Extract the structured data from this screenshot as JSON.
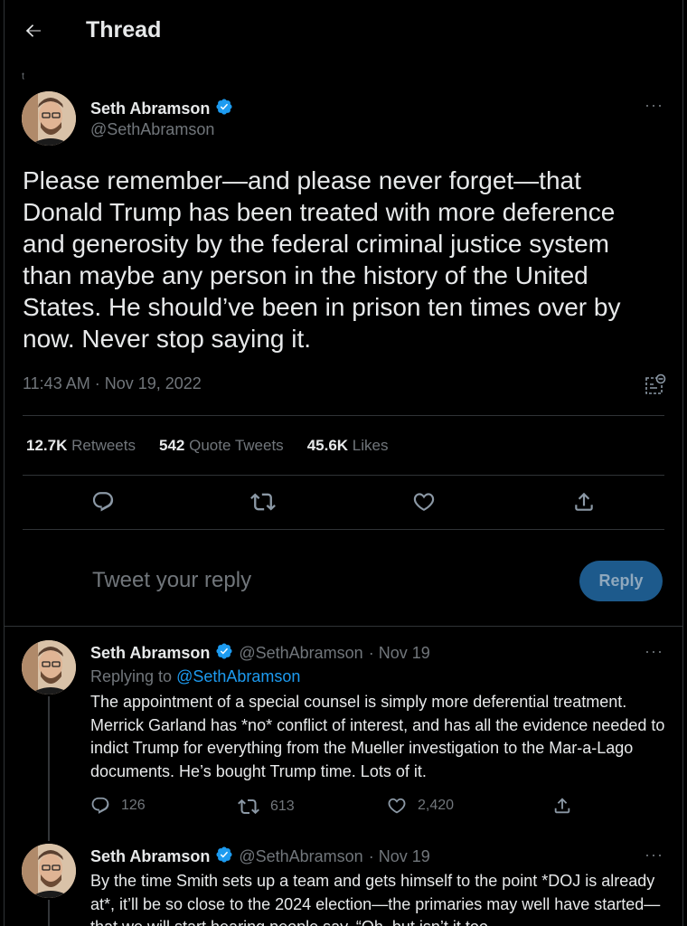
{
  "header": {
    "title": "Thread"
  },
  "main_tweet": {
    "name": "Seth Abramson",
    "handle": "@SethAbramson",
    "text": "Please remember—and please never forget—that Donald Trump has been treated with more deference and generosity by the federal criminal justice system than maybe any person in the history of the United States. He should’ve been in prison ten times over by now. Never stop saying it.",
    "timestamp": "11:43 AM · Nov 19, 2022",
    "stats": {
      "retweets_count": "12.7K",
      "retweets_label": "Retweets",
      "quotes_count": "542",
      "quotes_label": "Quote Tweets",
      "likes_count": "45.6K",
      "likes_label": "Likes"
    }
  },
  "reply_box": {
    "placeholder": "Tweet your reply",
    "button_label": "Reply"
  },
  "replies": [
    {
      "name": "Seth Abramson",
      "handle": "@SethAbramson",
      "date": "· Nov 19",
      "replying_label": "Replying to",
      "replying_handle": "@SethAbramson",
      "text": "The appointment of a special counsel is simply more deferential treatment. Merrick Garland has *no* conflict of interest, and has all the evidence needed to indict Trump for everything from the Mueller investigation to the Mar-a-Lago documents. He’s bought Trump time. Lots of it.",
      "replies_count": "126",
      "retweets_count": "613",
      "likes_count": "2,420"
    },
    {
      "name": "Seth Abramson",
      "handle": "@SethAbramson",
      "date": "· Nov 19",
      "text": "By the time Smith sets up a team and gets himself to the point *DOJ is already at*, it’ll be so close to the 2024 election—the primaries may well have started—that we will start hearing people say, “Oh, but isn’t it too"
    }
  ],
  "colors": {
    "accent": "#1d9bf0",
    "reply_button": "#1d5a8c",
    "muted": "#71767b",
    "divider": "#2f3336"
  }
}
